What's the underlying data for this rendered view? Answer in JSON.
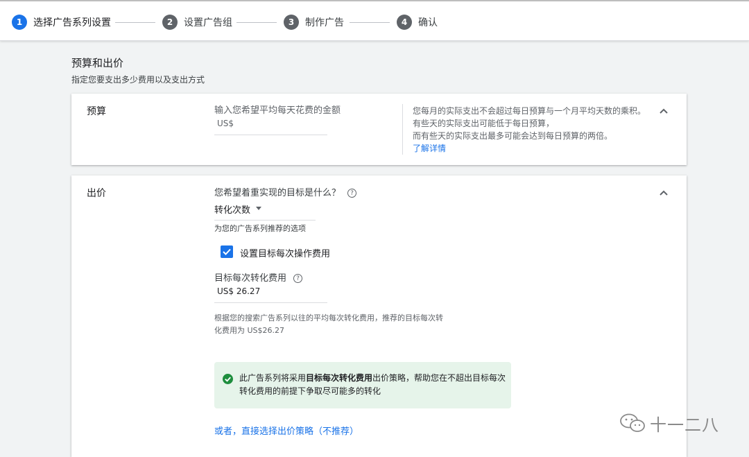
{
  "stepper": {
    "steps": [
      {
        "num": "1",
        "label": "选择广告系列设置"
      },
      {
        "num": "2",
        "label": "设置广告组"
      },
      {
        "num": "3",
        "label": "制作广告"
      },
      {
        "num": "4",
        "label": "确认"
      }
    ]
  },
  "section": {
    "title": "预算和出价",
    "subtitle": "指定您要支出多少费用以及支出方式"
  },
  "budget": {
    "title": "预算",
    "input_label": "输入您希望平均每天花费的金额",
    "currency": "US$",
    "info_lines": [
      "您每月的实际支出不会超过每日预算与一个月平均天数的乘积。",
      "有些天的实际支出可能低于每日预算，",
      "而有些天的实际支出最多可能会达到每日预算的两倍。"
    ],
    "learn_more": "了解详情"
  },
  "bidding": {
    "title": "出价",
    "goal_question": "您希望着重实现的目标是什么？",
    "help_glyph": "?",
    "goal_value": "转化次数",
    "recommended_note": "为您的广告系列推荐的选项",
    "checkbox_label": "设置目标每次操作费用",
    "target_cpa_label": "目标每次转化费用",
    "target_cpa_value": "US$ 26.27",
    "recommendation_line1": "根据您的搜索广告系列以往的平均每次转化费用，推荐的目标每次转",
    "recommendation_line2": "化费用为 US$26.27",
    "success_prefix": "此广告系列将采用",
    "success_bold": "目标每次转化费用",
    "success_suffix": "出价策略，帮助您在不超出目标每次转化费用的前提下争取尽可能多的转化",
    "alt_link": "或者，直接选择出价策略（不推荐）"
  },
  "watermark": {
    "text": "十一二八"
  },
  "colors": {
    "accent": "#1a73e8",
    "success_bg": "#e6f4ea",
    "success_icon": "#1e8e3e"
  }
}
